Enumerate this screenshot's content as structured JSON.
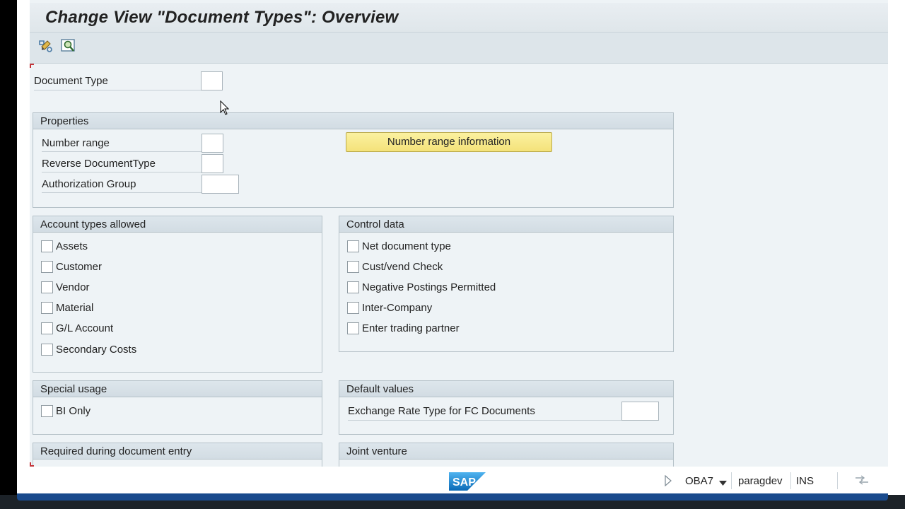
{
  "window": {
    "title": "Change View \"Document Types\": Overview"
  },
  "toolbar": {
    "icons": [
      "display-change-icon",
      "find-icon"
    ]
  },
  "header_field": {
    "label": "Document Type",
    "value": ""
  },
  "properties": {
    "title": "Properties",
    "fields": [
      {
        "label": "Number range",
        "value": ""
      },
      {
        "label": "Reverse DocumentType",
        "value": ""
      },
      {
        "label": "Authorization Group",
        "value": ""
      }
    ],
    "button_label": "Number range information"
  },
  "account_types": {
    "title": "Account types allowed",
    "items": [
      "Assets",
      "Customer",
      "Vendor",
      "Material",
      "G/L Account",
      "Secondary Costs"
    ]
  },
  "control_data": {
    "title": "Control data",
    "items": [
      "Net document type",
      "Cust/vend Check",
      "Negative Postings Permitted",
      "Inter-Company",
      "Enter trading partner"
    ]
  },
  "special_usage": {
    "title": "Special usage",
    "items": [
      "BI Only"
    ]
  },
  "default_values": {
    "title": "Default values",
    "field_label": "Exchange Rate Type for FC Documents",
    "value": ""
  },
  "required_entry": {
    "title": "Required during document entry"
  },
  "joint_venture": {
    "title": "Joint venture"
  },
  "status": {
    "transaction": "OBA7",
    "user": "paragdev",
    "mode": "INS"
  },
  "colors": {
    "accent_button": "#f4e27a",
    "group_header": "#d2dce3",
    "background": "#eef3f6"
  }
}
